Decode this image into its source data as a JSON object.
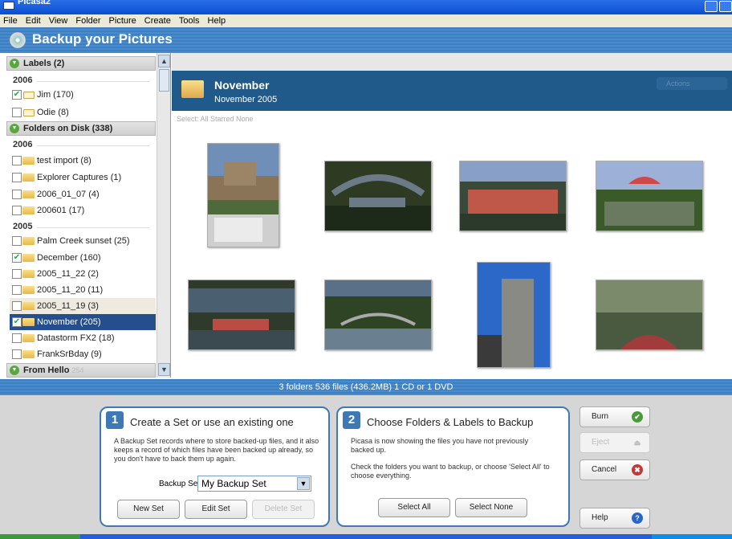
{
  "window": {
    "title": "Picasa2"
  },
  "menu": [
    "File",
    "Edit",
    "View",
    "Folder",
    "Picture",
    "Create",
    "Tools",
    "Help"
  ],
  "header": {
    "title": "Backup your Pictures"
  },
  "sidebar": {
    "labels_header": "Labels (2)",
    "labels_year": "2006",
    "labels": [
      {
        "text": "Jim (170)",
        "checked": true
      },
      {
        "text": "Odie (8)",
        "checked": false
      }
    ],
    "folders_header": "Folders on Disk (338)",
    "year_2006": "2006",
    "folders_2006": [
      {
        "text": "test import (8)",
        "checked": false
      },
      {
        "text": "Explorer Captures (1)",
        "checked": false
      },
      {
        "text": "2006_01_07 (4)",
        "checked": false
      },
      {
        "text": "200601 (17)",
        "checked": false
      }
    ],
    "year_2005": "2005",
    "folders_2005": [
      {
        "text": "Palm Creek sunset (25)",
        "checked": false
      },
      {
        "text": "December (160)",
        "checked": true
      },
      {
        "text": "2005_11_22 (2)",
        "checked": false
      },
      {
        "text": "2005_11_20 (11)",
        "checked": false
      },
      {
        "text": "2005_11_19 (3)",
        "checked": false
      },
      {
        "text": "November (205)",
        "checked": true
      },
      {
        "text": "Datastorm FX2 (18)",
        "checked": false
      },
      {
        "text": "FrankSrBday (9)",
        "checked": false
      }
    ],
    "from_header": "From Hello",
    "from_count": "254"
  },
  "album": {
    "name": "November",
    "date": "November 2005",
    "actions": "Actions",
    "select_line": "Select:  All  Starred  None"
  },
  "photos": [
    {
      "name": "alamo-photo",
      "palette": [
        "#6f8fb8",
        "#8a7458",
        "#cfcfcf"
      ]
    },
    {
      "name": "river-walk-arch-photo",
      "palette": [
        "#2e3a22",
        "#6c7a88",
        "#1d2a1a"
      ]
    },
    {
      "name": "tour-boat-photo",
      "palette": [
        "#88a0c8",
        "#c0584a",
        "#3a4a3a"
      ]
    },
    {
      "name": "umbrella-patio-photo",
      "palette": [
        "#9cb0d8",
        "#d04848",
        "#3a5a2a"
      ]
    },
    {
      "name": "boat-landing-photo",
      "palette": [
        "#2f3a2a",
        "#bb4c44",
        "#4a6070"
      ]
    },
    {
      "name": "bridge-photo",
      "palette": [
        "#5a7088",
        "#2e4424",
        "#6a8090"
      ]
    },
    {
      "name": "tower-photo",
      "palette": [
        "#2c68c8",
        "#8a8a84",
        "#3a3a3a"
      ]
    },
    {
      "name": "boat-bow-photo",
      "palette": [
        "#7a8a6a",
        "#a03c3c",
        "#4a5a40"
      ]
    }
  ],
  "status": "3 folders 536 files (436.2MB) 1 CD or 1 DVD",
  "panel1": {
    "number": "1",
    "title": "Create a Set or use an existing one",
    "desc": "A Backup Set records where to store backed-up files, and it also keeps a record of which files have been backed up already, so you don't have to back them up again.",
    "set_label": "Backup Set",
    "set_value": "My Backup Set",
    "btn_new": "New Set",
    "btn_edit": "Edit Set",
    "btn_delete": "Delete Set"
  },
  "panel2": {
    "number": "2",
    "title": "Choose Folders & Labels to Backup",
    "desc1": "Picasa is now showing the files you have not previously backed up.",
    "desc2": "Check the folders you want to backup, or choose 'Select All' to choose everything.",
    "btn_all": "Select All",
    "btn_none": "Select None"
  },
  "side_buttons": {
    "burn": "Burn",
    "eject": "Eject",
    "cancel": "Cancel",
    "help": "Help"
  }
}
